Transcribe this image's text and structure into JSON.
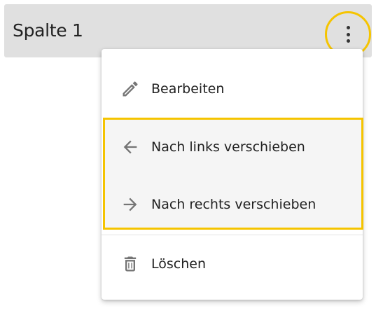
{
  "column": {
    "title": "Spalte 1",
    "more_icon": "more-vert-icon"
  },
  "menu": {
    "items": [
      {
        "label": "Bearbeiten",
        "icon": "pencil-icon"
      },
      {
        "label": "Nach links verschieben",
        "icon": "arrow-left-icon"
      },
      {
        "label": "Nach rechts verschieben",
        "icon": "arrow-right-icon"
      },
      {
        "label": "Löschen",
        "icon": "trash-icon"
      }
    ]
  },
  "colors": {
    "highlight": "#f5c400",
    "header_bg": "#e0e0e0",
    "icon": "#757575",
    "text": "#212121"
  }
}
